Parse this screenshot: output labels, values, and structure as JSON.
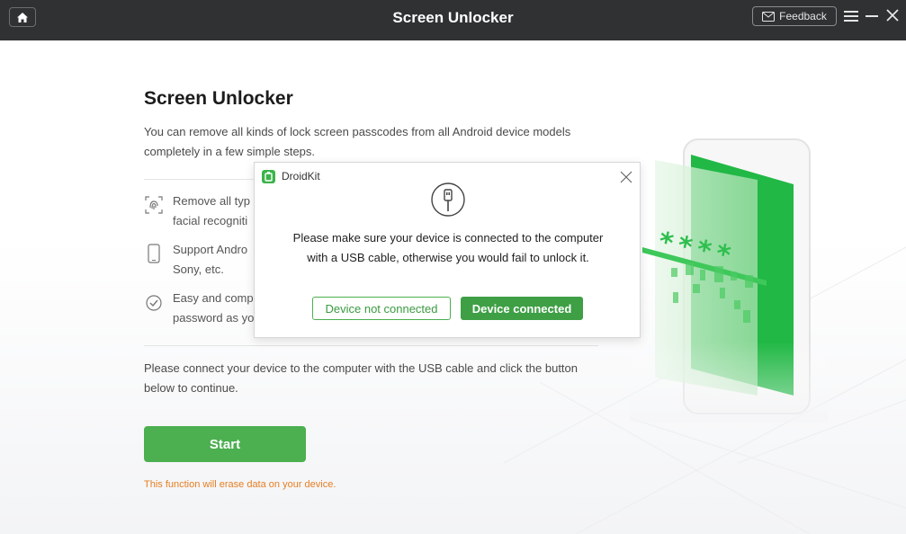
{
  "window": {
    "title": "Screen Unlocker",
    "feedback_label": "Feedback",
    "icons": [
      "home-icon",
      "mail-icon",
      "menu-icon",
      "minimize-icon",
      "close-icon"
    ]
  },
  "main": {
    "title": "Screen Unlocker",
    "description": "You can remove all kinds of lock screen passcodes from all Android device models completely in a few simple steps.",
    "features": [
      {
        "icon": "fingerprint-icon",
        "text": "Remove all typ\nfacial recogniti"
      },
      {
        "icon": "phone-icon",
        "text": "Support Andro\nSony, etc."
      },
      {
        "icon": "check-circle-icon",
        "text": "Easy and comp\npassword as yo"
      }
    ],
    "connect_text": "Please connect your device to the computer with the USB cable and click the button below to continue.",
    "start_label": "Start",
    "warning": "This function will erase data on your device."
  },
  "dialog": {
    "app_name": "DroidKit",
    "message": "Please make sure your device is connected to the computer with a USB cable, otherwise you would fail to unlock it.",
    "not_connected_label": "Device not connected",
    "connected_label": "Device connected",
    "illustration_text": "****"
  },
  "colors": {
    "titlebar": "#2f3133",
    "accent_green": "#4caf50",
    "warning": "#e67e22"
  }
}
